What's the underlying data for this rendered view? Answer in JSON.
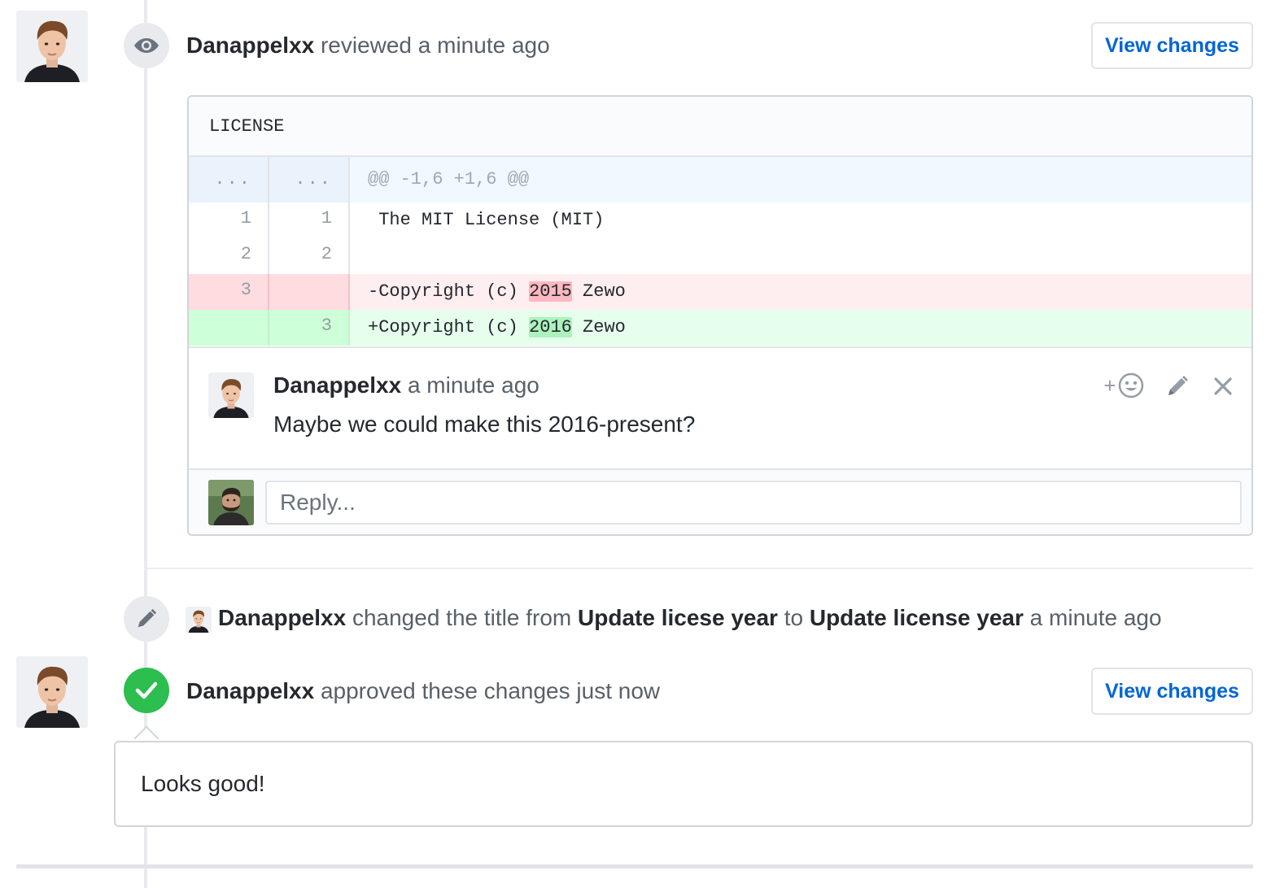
{
  "review": {
    "author": "Danappelxx",
    "action": "reviewed a minute ago",
    "view_changes": "View changes",
    "file": {
      "name": "LICENSE",
      "hunk_old": "...",
      "hunk_new": "...",
      "hunk_header": "@@ -1,6 +1,6 @@",
      "lines": [
        {
          "old": "1",
          "new": "1",
          "text": " The MIT License (MIT)"
        },
        {
          "old": "2",
          "new": "2",
          "text": ""
        }
      ],
      "deleted": {
        "old": "3",
        "prefix": "-Copyright (c) ",
        "highlight": "2015",
        "suffix": " Zewo"
      },
      "added": {
        "new": "3",
        "prefix": "+Copyright (c) ",
        "highlight": "2016",
        "suffix": " Zewo"
      }
    },
    "comment": {
      "author": "Danappelxx",
      "time": "a minute ago",
      "body": "Maybe we could make this 2016-present?",
      "add_reaction": "+"
    },
    "reply_placeholder": "Reply..."
  },
  "rename_event": {
    "author": "Danappelxx",
    "text1": "changed the title from",
    "old_title": "Update licese year",
    "text2": "to",
    "new_title": "Update license year",
    "time": "a minute ago"
  },
  "approval": {
    "author": "Danappelxx",
    "action": "approved these changes just now",
    "view_changes": "View changes",
    "body": "Looks good!"
  },
  "colors": {
    "link": "#0366d6",
    "approved_green": "#2cbe4e",
    "deleted_bg": "#ffeef0",
    "added_bg": "#e6ffed"
  }
}
